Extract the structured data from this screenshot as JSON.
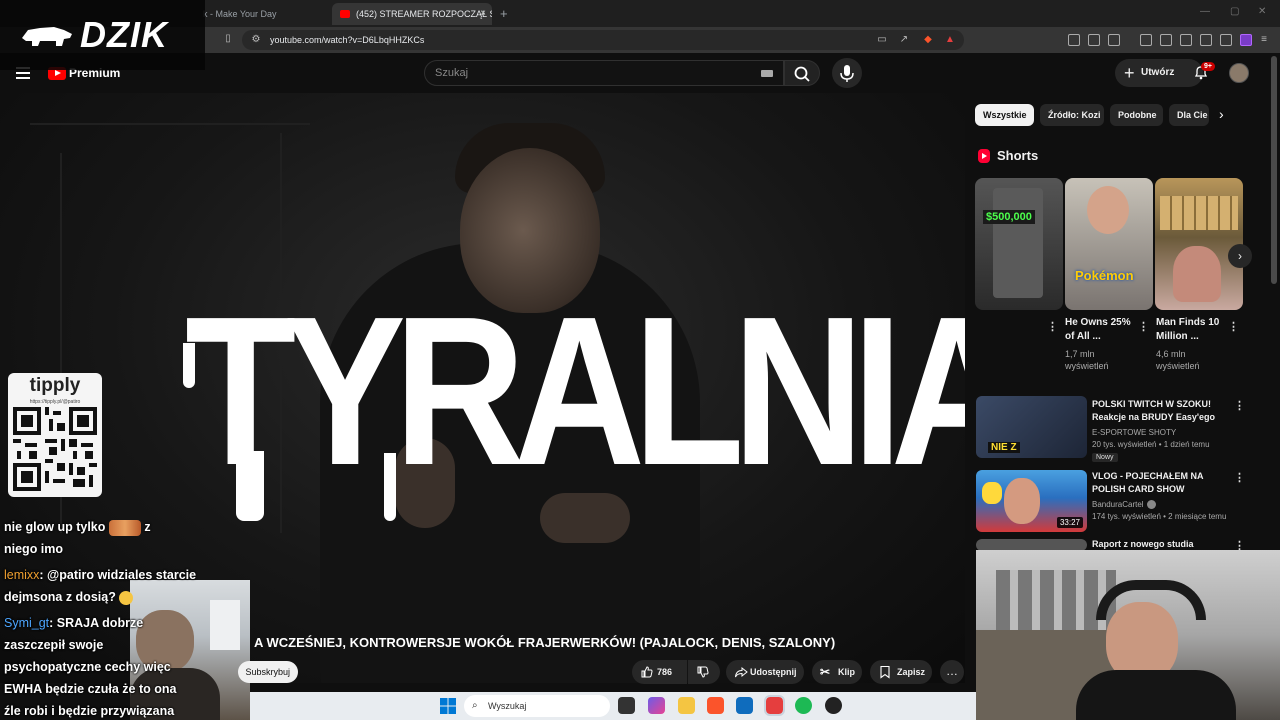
{
  "browser": {
    "tabs": [
      {
        "label": "k - Make Your Day",
        "active": false
      },
      {
        "label": "(452) STREAMER ROZPOCZĄŁ ST",
        "active": true
      }
    ],
    "url": "youtube.com/watch?v=D6LbqHHZKCs",
    "tab_close_glyph": "×",
    "new_tab_glyph": "+"
  },
  "overlay": {
    "brand": "DZIK",
    "tipply": {
      "logo": "tipply",
      "url": "https://tipply.pl/@patiro"
    }
  },
  "youtube": {
    "premium_label": "Premium",
    "search_placeholder": "Szukaj",
    "create_label": "Utwórz",
    "notifications_badge": "9+",
    "video": {
      "overlay_text": "TYRALNIA",
      "title_fragment": "A WCZEŚNIEJ, KONTROWERSJE WOKÓŁ FRAJERWERKÓW! (PAJALOCK, DENIS, SZALONY)"
    },
    "actions": {
      "subscribe": "Subskrybuj",
      "likes": "786",
      "share": "Udostępnij",
      "clip": "Klip",
      "save": "Zapisz",
      "more": "…"
    },
    "chips": [
      "Wszystkie",
      "Źródło: Kozi",
      "Podobne",
      "Dla Cie"
    ],
    "shorts": {
      "section_title": "Shorts",
      "price_tag": "$500,000",
      "pokemon_text": "Pokémon",
      "items": [
        {
          "title": "",
          "views": ""
        },
        {
          "title": "He Owns 25% of All ...",
          "views": "1,7 mln wyświetleń"
        },
        {
          "title": "Man Finds 10 Million ...",
          "views": "4,6 mln wyświetleń"
        }
      ]
    },
    "recommended": [
      {
        "title": "POLSKI TWITCH W SZOKU! Reakcje na BRUDY Easy'ego",
        "channel": "E-SPORTOWE SHOTY",
        "meta": "20 tys. wyświetleń • 1 dzień temu",
        "badge": "Nowy",
        "thumb_text": "NIE Z",
        "duration": ""
      },
      {
        "title": "VLOG - POJECHAŁEM NA POLISH CARD SHOW",
        "channel": "BanduraCartel",
        "meta": "174 tys. wyświetleń • 2 miesiące temu",
        "badge": "",
        "thumb_text": "",
        "duration": "33:27"
      },
      {
        "title": "Raport z nowego studia",
        "channel": "",
        "meta": "",
        "badge": "",
        "thumb_text": "",
        "duration": ""
      }
    ]
  },
  "chat": [
    {
      "user": "",
      "text_before": "nie glow up tylko",
      "text_after": "z niego imo",
      "user_color": "#ffffff"
    },
    {
      "user": "lemixx",
      "text": ": @patiro widziales starcie dejmsona z dosią?",
      "user_color": "#f0a030"
    },
    {
      "user": "Symi_gt",
      "text": ": SRAJA dobrze zaszczepił swoje psychopatyczne cechy więc EWHA będzie czuła że to ona źle robi i będzie przywiązana",
      "user_color": "#4da6ff"
    }
  ],
  "taskbar": {
    "search_placeholder": "Wyszukaj"
  }
}
